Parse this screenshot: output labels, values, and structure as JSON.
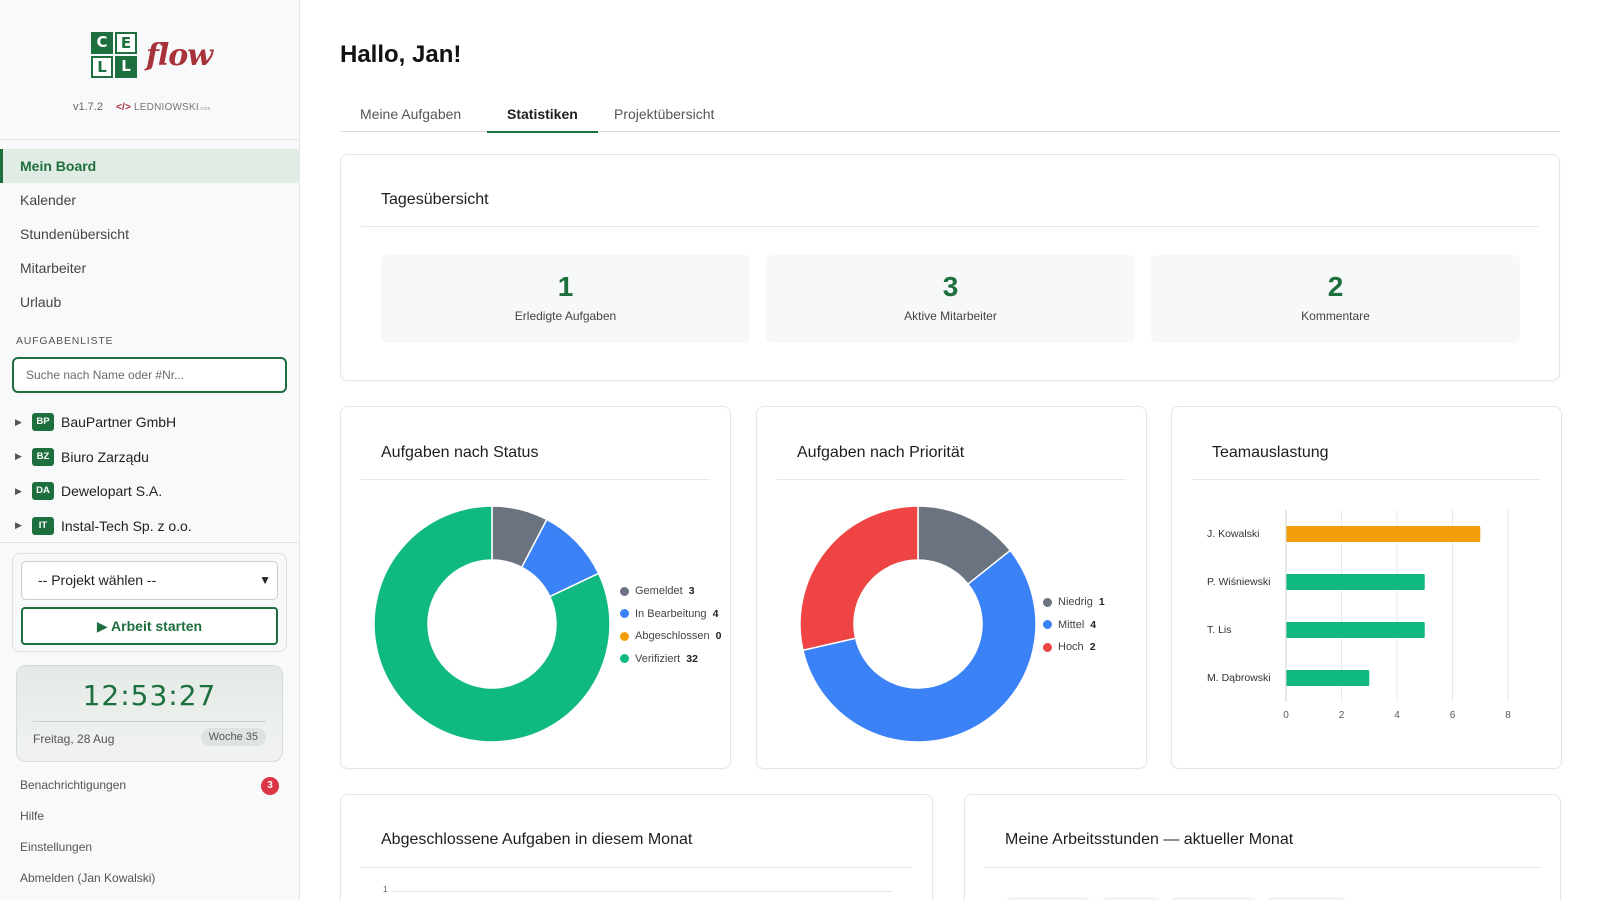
{
  "app": {
    "logo_letters": [
      "C",
      "E",
      "L",
      "L"
    ],
    "logo_word": "flow",
    "version": "v1.7.2",
    "author_tag": "</>",
    "author": "LEDNIOWSKI",
    "author_tld": ".com"
  },
  "sidebar": {
    "nav": [
      {
        "label": "Mein Board",
        "active": true
      },
      {
        "label": "Kalender"
      },
      {
        "label": "Stundenübersicht"
      },
      {
        "label": "Mitarbeiter"
      },
      {
        "label": "Urlaub"
      }
    ],
    "tasklist_title": "AUFGABENLISTE",
    "search_placeholder": "Suche nach Name oder #Nr...",
    "clients": [
      {
        "badge": "BP",
        "name": "BauPartner GmbH"
      },
      {
        "badge": "BZ",
        "name": "Biuro Zarządu"
      },
      {
        "badge": "DA",
        "name": "Dewelopart S.A."
      },
      {
        "badge": "IT",
        "name": "Instal-Tech Sp. z o.o."
      }
    ],
    "project_select": "-- Projekt wählen --",
    "start_button": "▶ Arbeit starten",
    "clock": "12:53:27",
    "date": "Freitag, 28 Aug",
    "week": "Woche 35",
    "notifications_label": "Benachrichtigungen",
    "notifications_count": "3",
    "help": "Hilfe",
    "settings": "Einstellungen",
    "logout": "Abmelden (Jan Kowalski)"
  },
  "main": {
    "greeting": "Hallo, Jan!",
    "tabs": [
      "Meine Aufgaben",
      "Statistiken",
      "Projektübersicht"
    ],
    "active_tab": "Statistiken",
    "daily": {
      "title": "Tagesübersicht",
      "stats": [
        {
          "value": "1",
          "label": "Erledigte Aufgaben"
        },
        {
          "value": "3",
          "label": "Aktive Mitarbeiter"
        },
        {
          "value": "2",
          "label": "Kommentare"
        }
      ]
    },
    "status_title": "Aufgaben nach Status",
    "priority_title": "Aufgaben nach Priorität",
    "team_title": "Teamauslastung",
    "completed_title": "Abgeschlossene Aufgaben in diesem Monat",
    "hours_title": "Meine Arbeitsstunden — aktueller Monat",
    "completed_axis_tick": "1"
  },
  "colors": {
    "brand": "#1e6f3e",
    "logo_red": "#a8323a",
    "gray": "#6b7280",
    "blue": "#3b82f6",
    "orange": "#f59e0b",
    "green": "#10b981",
    "red": "#ef4444"
  },
  "chart_data": [
    {
      "type": "pie",
      "title": "Aufgaben nach Status",
      "donut": true,
      "labels": [
        "Gemeldet",
        "In Bearbeitung",
        "Abgeschlossen",
        "Verifiziert"
      ],
      "values": [
        3,
        4,
        0,
        32
      ],
      "colors": [
        "#6b7280",
        "#3b82f6",
        "#f59e0b",
        "#10b981"
      ],
      "legend": "right"
    },
    {
      "type": "pie",
      "title": "Aufgaben nach Priorität",
      "donut": true,
      "labels": [
        "Niedrig",
        "Mittel",
        "Hoch"
      ],
      "values": [
        1,
        4,
        2
      ],
      "colors": [
        "#6b7280",
        "#3b82f6",
        "#ef4444"
      ],
      "legend": "right"
    },
    {
      "type": "bar",
      "orientation": "horizontal",
      "title": "Teamauslastung",
      "categories": [
        "J. Kowalski",
        "P. Wiśniewski",
        "T. Lis",
        "M. Dąbrowski"
      ],
      "values": [
        7,
        5,
        5,
        3
      ],
      "colors": [
        "#f59e0b",
        "#10b981",
        "#10b981",
        "#10b981"
      ],
      "xticks": [
        "0",
        "2",
        "4",
        "6",
        "8"
      ],
      "xlim": [
        0,
        8
      ],
      "grid": true
    }
  ]
}
